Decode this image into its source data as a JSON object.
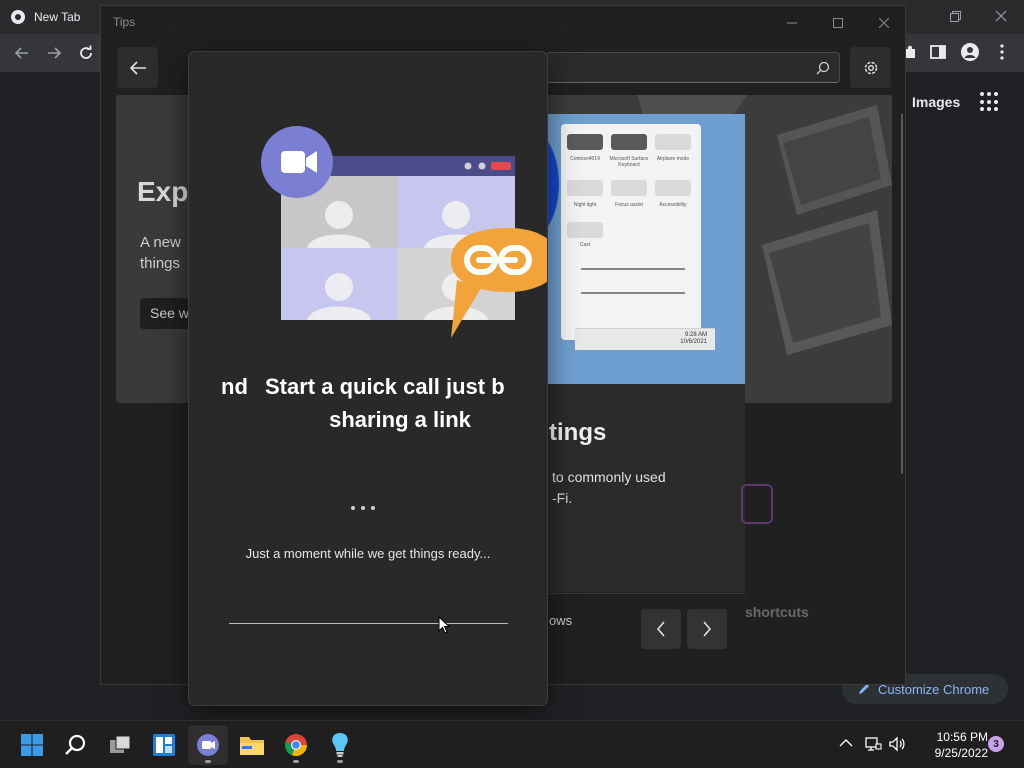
{
  "chrome": {
    "tab_title": "New Tab",
    "images_link": "Images",
    "customize_label": "Customize Chrome"
  },
  "tips": {
    "window_title": "Tips",
    "hero": {
      "heading": "Exp",
      "desc_line1": "A new",
      "desc_line2": "things",
      "button": "See w"
    },
    "card": {
      "title": "tings",
      "desc_line1": "to commonly used",
      "desc_line2": "-Fi.",
      "footer": "ows"
    },
    "bg_shortcuts": "shortcuts",
    "quick_settings": {
      "tiles": [
        "Contoso4019",
        "Microsoft Surface Keyboard",
        "Airplane mode",
        "Night light",
        "Focus assist",
        "Accessibility",
        "Cast"
      ],
      "time": "9:28 AM",
      "date": "10/6/2021"
    }
  },
  "popup": {
    "headline_prev": "nd",
    "headline_line1": "Start a quick call just b",
    "headline_line2": "sharing a link",
    "loading_text": "Just a moment while we get things ready..."
  },
  "taskbar": {
    "apps": [
      "start",
      "search",
      "task-view",
      "widgets",
      "teams-chat",
      "file-explorer",
      "chrome",
      "tips"
    ],
    "clock_time": "10:56 PM",
    "clock_date": "9/25/2022",
    "notification_count": "3"
  },
  "colors": {
    "teams_purple": "#6264a7",
    "link_orange": "#f2a33a",
    "chrome_accent": "#8ab4f8",
    "desktop_bg": "#202124"
  }
}
